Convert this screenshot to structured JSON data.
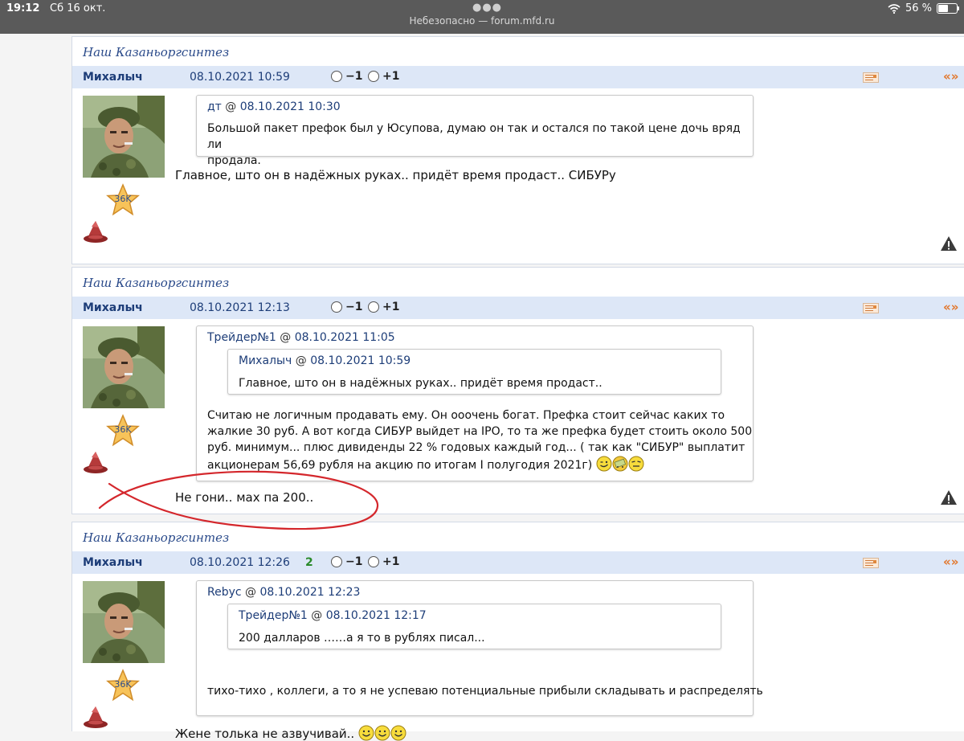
{
  "status_bar": {
    "time": "19:12",
    "date": "Сб 16 окт.",
    "url": "Небезопасно — forum.mfd.ru",
    "battery": "56 %",
    "battery_level": 56
  },
  "posts": [
    {
      "thread": "Наш Казаньоргсинтез",
      "author": "Михалыч",
      "date": "08.10.2021 10:59",
      "vote_minus": "−1",
      "vote_plus": "+1",
      "quote_arrows": "«»",
      "star_label": "36K",
      "quote": {
        "author": "дт",
        "at": "@",
        "date": "08.10.2021 10:30",
        "lines": [
          "Большой пакет префок был у Юсупова, думаю он так и остался по такой цене дочь вряд ли",
          "продала."
        ]
      },
      "message": "Главное, што он в надёжных руках.. придёт время продаст.. СИБУРу"
    },
    {
      "thread": "Наш Казаньоргсинтез",
      "author": "Михалыч",
      "date": "08.10.2021 12:13",
      "vote_minus": "−1",
      "vote_plus": "+1",
      "quote_arrows": "«»",
      "star_label": "36K",
      "quote": {
        "author": "Трейдер№1",
        "at": "@",
        "date": "08.10.2021 11:05",
        "inner": {
          "author": "Михалыч",
          "at": "@",
          "date": "08.10.2021 10:59",
          "text": "Главное, што он в надёжных руках.. придёт время продаст.."
        },
        "lines": [
          "Считаю не логичным продавать ему. Он ооочень богат. Префка стоит сейчас каких то",
          "жалкие 30 руб. А вот когда СИБУР выйдет на IPO, то та же префка будет стоить около 500",
          "руб. минимум... плюс дивиденды 22 % годовых каждый год... ( так как \"СИБУР\" выплатит",
          "акционерам 56,69 рубля на акцию по итогам I полугодия 2021г)"
        ]
      },
      "message": "Не гони.. мах па 200.."
    },
    {
      "thread": "Наш Казаньоргсинтез",
      "author": "Михалыч",
      "date": "08.10.2021 12:26",
      "rating": "2",
      "vote_minus": "−1",
      "vote_plus": "+1",
      "quote_arrows": "«»",
      "star_label": "36K",
      "quote": {
        "author": "Rebyc",
        "at": "@",
        "date": "08.10.2021 12:23",
        "inner": {
          "author": "Трейдер№1",
          "at": "@",
          "date": "08.10.2021 12:17",
          "text": "200 далларов ……а я то в рублях писал..."
        },
        "lines": [
          "тихо-тихо , коллеги, а то я не успеваю потенциальные прибыли складывать и распределять"
        ]
      },
      "message": "Жене толька не азвучивай.."
    }
  ],
  "colors": {
    "header_bg": "#dde7f7",
    "link": "#1d3d78",
    "accent_orange": "#e2762a",
    "annotation_red": "#d4272c"
  }
}
